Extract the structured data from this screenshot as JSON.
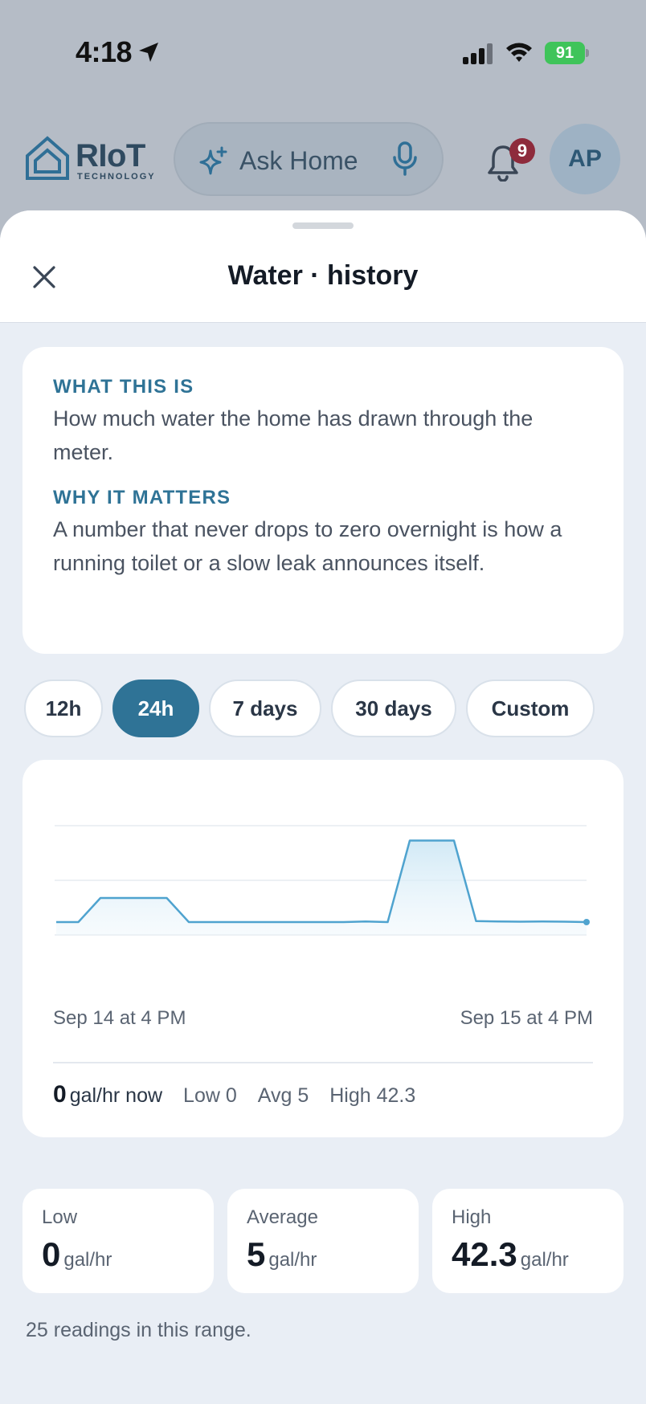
{
  "status_bar": {
    "time": "4:18",
    "battery": "91"
  },
  "header": {
    "logo_text": "RIoT",
    "logo_sub": "TECHNOLOGY",
    "ask_label": "Ask Home",
    "notification_count": "9",
    "avatar_initials": "AP"
  },
  "sheet": {
    "title": "Water · history",
    "info": {
      "what_heading": "WHAT THIS IS",
      "what_body": "How much water the home has drawn through the meter.",
      "why_heading": "WHY IT MATTERS",
      "why_body": "A number that never drops to zero overnight is how a running toilet or a slow leak announces itself."
    },
    "ranges": [
      {
        "label": "12h",
        "active": false
      },
      {
        "label": "24h",
        "active": true
      },
      {
        "label": "7 days",
        "active": false
      },
      {
        "label": "30 days",
        "active": false
      },
      {
        "label": "Custom",
        "active": false
      }
    ],
    "chart": {
      "x_start_label": "Sep 14 at 4 PM",
      "x_end_label": "Sep 15 at 4 PM"
    },
    "summary": {
      "now_value": "0",
      "now_unit": "gal/hr now",
      "low": "Low 0",
      "avg": "Avg 5",
      "high": "High 42.3"
    },
    "stats": [
      {
        "label": "Low",
        "value": "0",
        "unit": "gal/hr"
      },
      {
        "label": "Average",
        "value": "5",
        "unit": "gal/hr"
      },
      {
        "label": "High",
        "value": "42.3",
        "unit": "gal/hr"
      }
    ],
    "footnote": "25 readings in this range."
  },
  "colors": {
    "accent": "#2f7396",
    "line": "#4fa3cf"
  },
  "chart_data": {
    "type": "area",
    "x": [
      "Sep 14 at 4 PM",
      "",
      "",
      "",
      "",
      "",
      "",
      "",
      "",
      "",
      "",
      "",
      "",
      "",
      "",
      "",
      "",
      "",
      "",
      "",
      "",
      "",
      "",
      "",
      "Sep 15 at 4 PM"
    ],
    "values": [
      0,
      0,
      12.5,
      12.5,
      12.5,
      12.5,
      0,
      0,
      0,
      0,
      0,
      0,
      0,
      0,
      0.3,
      0,
      42.3,
      42.3,
      42.3,
      0.5,
      0.3,
      0.2,
      0.3,
      0.2,
      0
    ],
    "ylim": [
      0,
      50
    ]
  }
}
